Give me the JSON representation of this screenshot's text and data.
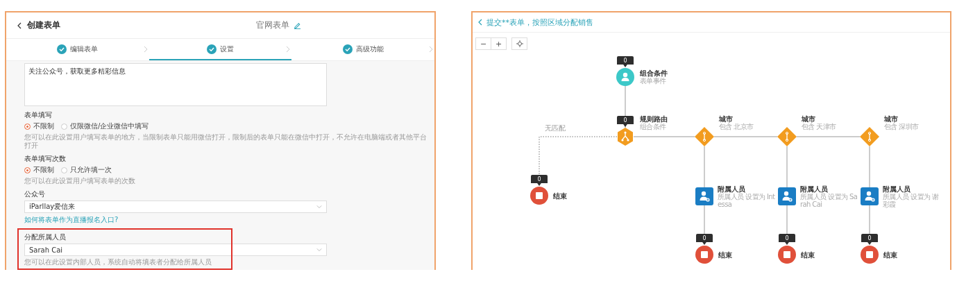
{
  "form_editor": {
    "header": {
      "back_label": "创建表单",
      "form_name": "官网表单"
    },
    "steps": [
      {
        "label": "编辑表单",
        "done": true,
        "selected": false
      },
      {
        "label": "设置",
        "done": true,
        "selected": true
      },
      {
        "label": "高级功能",
        "done": true,
        "selected": false
      }
    ],
    "message_box": {
      "value": "关注公众号，获取更多精彩信息"
    },
    "sections": [
      {
        "kind": "radio",
        "title": "表单填写",
        "options": [
          {
            "label": "不限制",
            "selected": true
          },
          {
            "label": "仅限微信/企业微信中填写",
            "selected": false
          }
        ],
        "hint": "您可以在此设置用户填写表单的地方，当限制表单只能用微信打开，限制后的表单只能在微信中打开，不允许在电脑端或者其他平台打开"
      },
      {
        "kind": "radio",
        "title": "表单填写次数",
        "options": [
          {
            "label": "不限制",
            "selected": true
          },
          {
            "label": "只允许填一次",
            "selected": false
          }
        ],
        "hint": "您可以在此设置用户填写表单的次数"
      },
      {
        "kind": "select",
        "title": "公众号",
        "value": "iParllay爱信来",
        "link": "如何将表单作为直播报名入口?",
        "highlighted": false
      },
      {
        "kind": "select",
        "title": "分配所属人员",
        "value": "Sarah Cai",
        "hint": "您可以在此设置内部人员，系统自动将填表者分配给所属人员",
        "highlighted": true
      }
    ]
  },
  "flow_editor": {
    "title": "提交**表单，按照区域分配销售",
    "zoom_controls": [
      "−",
      "+"
    ],
    "start": {
      "title": "组合条件",
      "subtitle": "表单事件",
      "count": "0"
    },
    "router": {
      "title": "规则路由",
      "subtitle": "组合条件",
      "count": "0"
    },
    "no_match": {
      "label": "无匹配",
      "end": {
        "title": "结束",
        "count": "0"
      }
    },
    "branches": [
      {
        "condition": {
          "title": "城市",
          "subtitle": "包含 北京市"
        },
        "assign": {
          "title": "附属人员",
          "subtitle": "所属人员 设置为 Intessa"
        },
        "end": {
          "title": "结束",
          "count": "0"
        }
      },
      {
        "condition": {
          "title": "城市",
          "subtitle": "包含 天津市"
        },
        "assign": {
          "title": "附属人员",
          "subtitle": "所属人员 设置为 Sarah Cai"
        },
        "end": {
          "title": "结束",
          "count": "0"
        }
      },
      {
        "condition": {
          "title": "城市",
          "subtitle": "包含 深圳市"
        },
        "assign": {
          "title": "附属人员",
          "subtitle": "所属人员 设置为 谢彩霞"
        },
        "end": {
          "title": "结束",
          "count": "0"
        }
      }
    ]
  }
}
